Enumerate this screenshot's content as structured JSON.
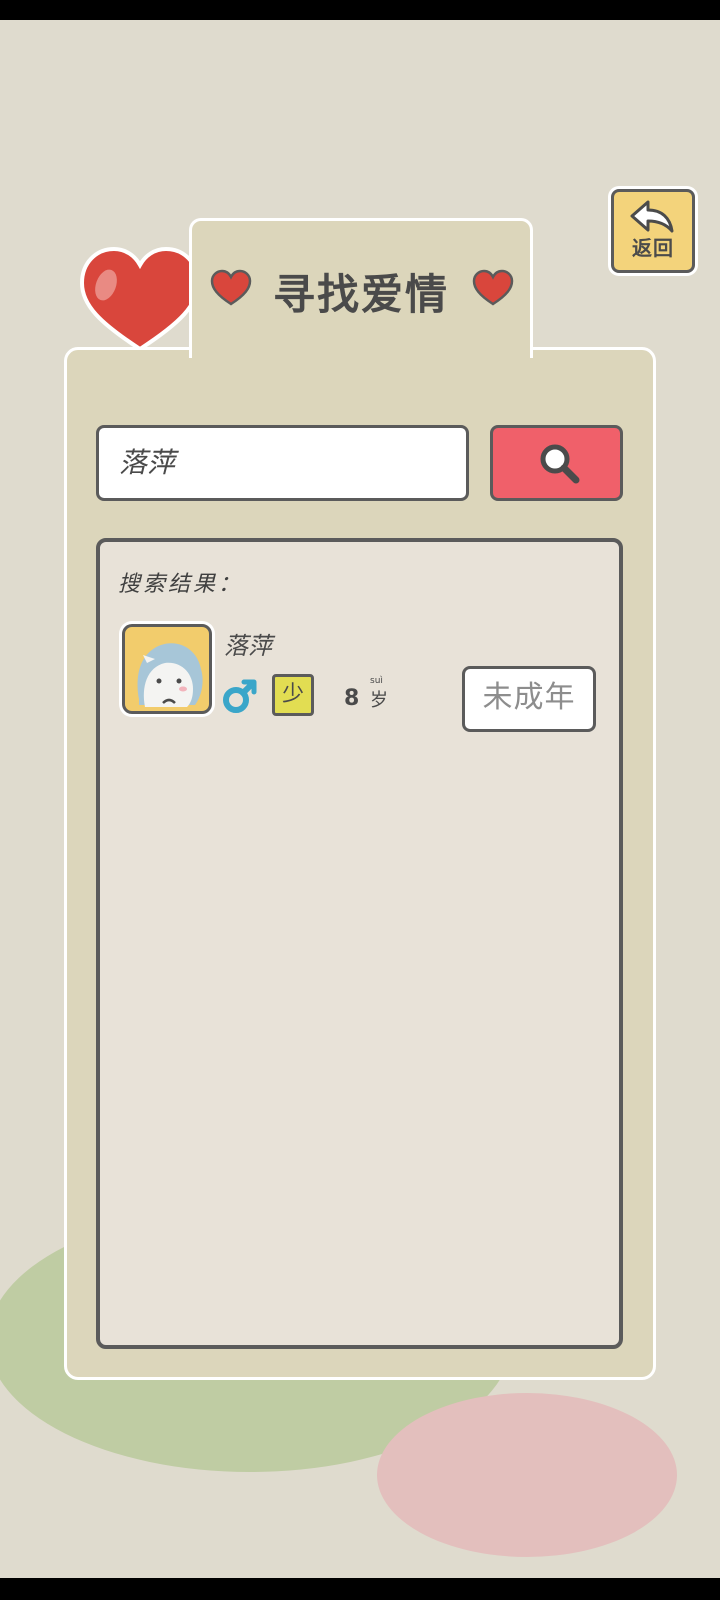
{
  "header": {
    "back_label": "返回",
    "title": "寻找爱情"
  },
  "search": {
    "query": "落萍"
  },
  "results": {
    "label": "搜索结果：",
    "items": [
      {
        "name": "落萍",
        "gender_icon": "male-icon",
        "stage_badge": "少",
        "age_number": "8",
        "age_unit": "岁",
        "age_pinyin": "suì",
        "status": "未成年"
      }
    ]
  },
  "colors": {
    "background": "#dfdbce",
    "panel": "#dcd6bb",
    "search_button": "#f0606a",
    "back_button": "#f3d37b",
    "stage_badge": "#e2dd52",
    "male_icon": "#3aa6c9",
    "heart": "#d9463c"
  }
}
